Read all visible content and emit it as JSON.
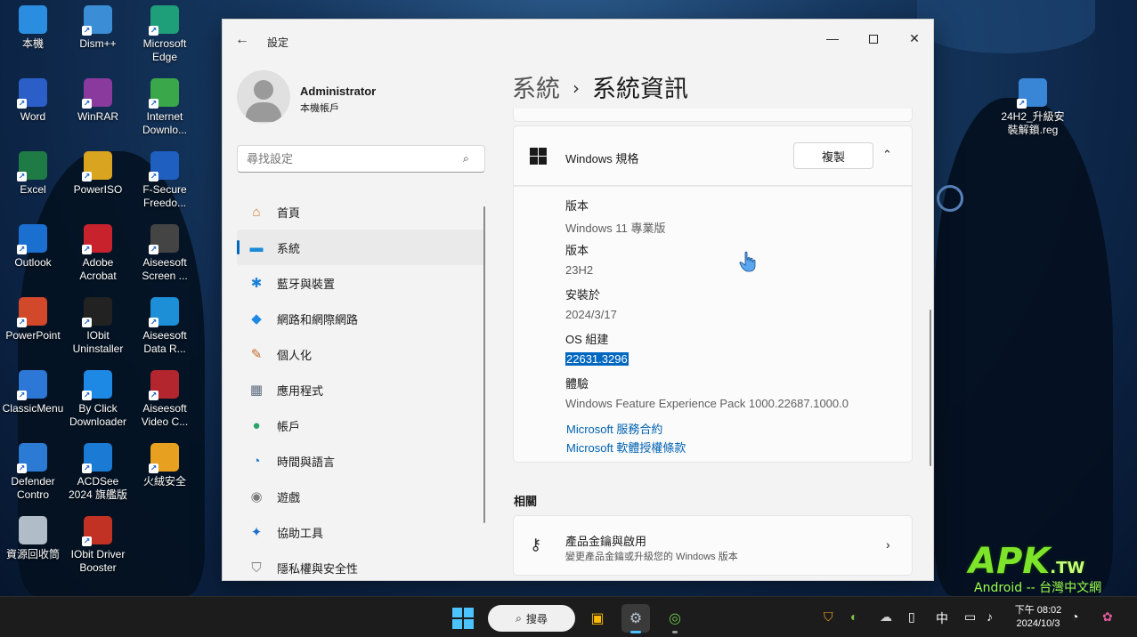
{
  "desktop": {
    "icons": [
      {
        "label": "本機",
        "color": "#2b8de0"
      },
      {
        "label": "Dism++",
        "color": "#3b8ed6"
      },
      {
        "label": "Microsoft Edge",
        "color": "#1f9e7a"
      },
      {
        "label": "Word",
        "color": "#2b5fc7"
      },
      {
        "label": "WinRAR",
        "color": "#8a3a9c"
      },
      {
        "label": "Internet Downlo...",
        "color": "#3aa84a"
      },
      {
        "label": "Excel",
        "color": "#1e7b45"
      },
      {
        "label": "PowerISO",
        "color": "#d9a520"
      },
      {
        "label": "F-Secure Freedo...",
        "color": "#1e5fc0"
      },
      {
        "label": "Outlook",
        "color": "#1a6fd0"
      },
      {
        "label": "Adobe Acrobat",
        "color": "#c8232c"
      },
      {
        "label": "Aiseesoft Screen ...",
        "color": "#444444"
      },
      {
        "label": "PowerPoint",
        "color": "#d2482a"
      },
      {
        "label": "IObit Uninstaller",
        "color": "#222222"
      },
      {
        "label": "Aiseesoft Data R...",
        "color": "#1d8fd6"
      },
      {
        "label": "ClassicMenu",
        "color": "#2d78d6"
      },
      {
        "label": "By Click Downloader",
        "color": "#1e88e5"
      },
      {
        "label": "Aiseesoft Video C...",
        "color": "#b3262e"
      },
      {
        "label": "Defender Contro",
        "color": "#2b7bd5"
      },
      {
        "label": "ACDSee 2024 旗艦版",
        "color": "#1a7ad4"
      },
      {
        "label": "火絨安全",
        "color": "#e8a020"
      },
      {
        "label": "資源回收筒",
        "color": "#b0bcc8"
      },
      {
        "label": "IObit Driver Booster",
        "color": "#c23224"
      }
    ],
    "right_icon": {
      "label": "24H2_升級安裝解鎖.reg",
      "color": "#3a86d6"
    }
  },
  "window": {
    "title": "設定",
    "back": "←",
    "minimize": "—",
    "close": "✕"
  },
  "profile": {
    "name": "Administrator",
    "sub": "本機帳戶"
  },
  "search": {
    "placeholder": "尋找設定"
  },
  "nav": {
    "items": [
      {
        "label": "首頁",
        "icon": "home-icon",
        "glyph": "⌂",
        "color": "#d07a2a"
      },
      {
        "label": "系統",
        "icon": "system-icon",
        "glyph": "▬",
        "color": "#1a8ad8"
      },
      {
        "label": "藍牙與裝置",
        "icon": "bluetooth-icon",
        "glyph": "✱",
        "color": "#1b7fd8"
      },
      {
        "label": "網路和網際網路",
        "icon": "wifi-icon",
        "glyph": "◆",
        "color": "#1e88e5"
      },
      {
        "label": "個人化",
        "icon": "brush-icon",
        "glyph": "✎",
        "color": "#c66a28"
      },
      {
        "label": "應用程式",
        "icon": "apps-icon",
        "glyph": "▦",
        "color": "#5c6c80"
      },
      {
        "label": "帳戶",
        "icon": "account-icon",
        "glyph": "●",
        "color": "#2aa36a"
      },
      {
        "label": "時間與語言",
        "icon": "time-language-icon",
        "glyph": "◔",
        "color": "#1e7bd0"
      },
      {
        "label": "遊戲",
        "icon": "gamepad-icon",
        "glyph": "◉",
        "color": "#7a7a7a"
      },
      {
        "label": "協助工具",
        "icon": "accessibility-icon",
        "glyph": "✦",
        "color": "#1b6fd0"
      },
      {
        "label": "隱私權與安全性",
        "icon": "shield-icon",
        "glyph": "⛉",
        "color": "#7a7a7a"
      }
    ]
  },
  "breadcrumb": {
    "parent": "系統",
    "separator": "›",
    "current": "系統資訊"
  },
  "spec": {
    "title": "Windows 規格",
    "copy_label": "複製",
    "chevron": "⌃",
    "rows": [
      {
        "label": "版本",
        "value": "Windows 11 專業版"
      },
      {
        "label": "版本",
        "value": "23H2"
      },
      {
        "label": "安裝於",
        "value": "2024/3/17"
      },
      {
        "label": "OS 組建",
        "value": "22631.3296"
      },
      {
        "label": "體驗",
        "value": "Windows Feature Experience Pack 1000.22687.1000.0"
      }
    ],
    "links": [
      "Microsoft 服務合約",
      "Microsoft 軟體授權條款"
    ]
  },
  "related": {
    "heading": "相關",
    "card_title": "產品金鑰與啟用",
    "card_sub": "變更產品金鑰或升級您的 Windows 版本",
    "chevron": "›"
  },
  "taskbar": {
    "search_label": "搜尋",
    "search_glyph": "⌕",
    "apps": [
      {
        "icon": "store-icon",
        "glyph": "▣",
        "color": "#ffb900"
      },
      {
        "icon": "settings-gear-icon",
        "glyph": "⚙",
        "color": "#b8c4d0"
      },
      {
        "icon": "internet-download-icon",
        "glyph": "◎",
        "color": "#6cc24a"
      }
    ],
    "tray": {
      "ime": "中",
      "icons": [
        "firewall-icon",
        "network-app-icon",
        "cloud-off-icon",
        "usb-icon",
        "display-icon",
        "volume-icon",
        "bell-icon",
        "copilot-icon"
      ],
      "glyphs": [
        "⛉",
        "◐",
        "☁",
        "▯",
        "▭",
        "♪",
        "◔",
        "✿"
      ]
    },
    "clock_time": "下午 08:02",
    "clock_date": "2024/10/3"
  },
  "watermark": {
    "brand": "APK",
    "suffix": ".TW",
    "sub": "Android -- 台灣中文網"
  }
}
